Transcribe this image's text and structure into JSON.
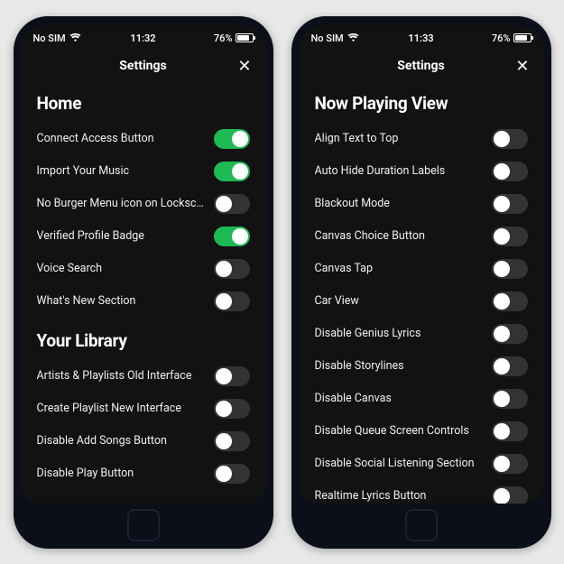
{
  "phones": [
    {
      "status": {
        "carrier": "No SIM",
        "time": "11:32",
        "battery": "76%"
      },
      "header": {
        "title": "Settings"
      },
      "sections": [
        {
          "title": "Home",
          "rows": [
            {
              "label": "Connect Access Button",
              "on": true
            },
            {
              "label": "Import Your Music",
              "on": true
            },
            {
              "label": "No Burger Menu icon on Lockscreen",
              "on": false
            },
            {
              "label": "Verified Profile Badge",
              "on": true
            },
            {
              "label": "Voice Search",
              "on": false
            },
            {
              "label": "What's New Section",
              "on": false
            }
          ]
        },
        {
          "title": "Your Library",
          "rows": [
            {
              "label": "Artists & Playlists Old Interface",
              "on": false
            },
            {
              "label": "Create Playlist New Interface",
              "on": false
            },
            {
              "label": "Disable Add Songs Button",
              "on": false
            },
            {
              "label": "Disable Play Button",
              "on": false
            }
          ]
        }
      ]
    },
    {
      "status": {
        "carrier": "No SIM",
        "time": "11:33",
        "battery": "76%"
      },
      "header": {
        "title": "Settings"
      },
      "sections": [
        {
          "title": "Now Playing View",
          "rows": [
            {
              "label": "Align Text to Top",
              "on": false
            },
            {
              "label": "Auto Hide Duration Labels",
              "on": false
            },
            {
              "label": "Blackout Mode",
              "on": false
            },
            {
              "label": "Canvas Choice Button",
              "on": false
            },
            {
              "label": "Canvas Tap",
              "on": false
            },
            {
              "label": "Car View",
              "on": false
            },
            {
              "label": "Disable Genius Lyrics",
              "on": false
            },
            {
              "label": "Disable Storylines",
              "on": false
            },
            {
              "label": "Disable Canvas",
              "on": false
            },
            {
              "label": "Disable Queue Screen Controls",
              "on": false
            },
            {
              "label": "Disable Social Listening Section",
              "on": false
            },
            {
              "label": "Realtime Lyrics Button",
              "on": false
            }
          ]
        }
      ]
    }
  ]
}
